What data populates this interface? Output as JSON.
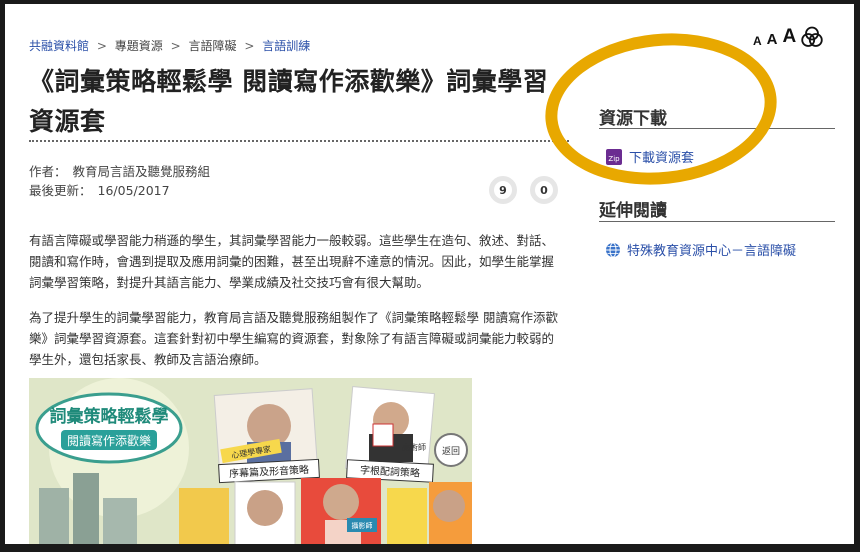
{
  "breadcrumb": {
    "items": [
      "共融資料館",
      "專題資源",
      "言語障礙",
      "言語訓練"
    ],
    "separator": ">"
  },
  "title": "《詞彙策略輕鬆學 閱讀寫作添歡樂》詞彙學習資源套",
  "meta": {
    "author_label": "作者：",
    "author_value": "教育局言語及聽覺服務組",
    "updated_label": "最後更新：",
    "updated_value": "16/05/2017",
    "like_count": "9",
    "share_count": "0"
  },
  "paragraphs": [
    "有語言障礙或學習能力稍遜的學生，其詞彙學習能力一般較弱。這些學生在造句、敘述、對話、閱讀和寫作時，會遇到提取及應用詞彙的困難，甚至出現辭不達意的情況。因此，如學生能掌握詞彙學習策略，對提升其語言能力、學業成績及社交技巧會有很大幫助。",
    "為了提升學生的詞彙學習能力，教育局言語及聽覺服務組製作了《詞彙策略輕鬆學 閱讀寫作添歡樂》詞彙學習資源套。這套針對初中學生編寫的資源套，對象除了有語言障礙或詞彙能力較弱的學生外，還包括家長、教師及言語治療師。"
  ],
  "banner": {
    "logo_title": "詞彙策略輕鬆學",
    "logo_subtitle": "閱讀寫作添歡樂",
    "back_label": "返回",
    "card1_label": "序幕篇及形音策略",
    "card2_label": "字根配詞策略",
    "tag1": "心理學專家",
    "tag2": "魔術師",
    "tag3": "攝影師"
  },
  "font_tools": {
    "small": "A",
    "medium": "A",
    "large": "A"
  },
  "sidebar": {
    "resources_heading": "資源下載",
    "download_link": "下載資源套",
    "zip_label": "Zip",
    "extended_heading": "延伸閱讀",
    "extended_link": "特殊教育資源中心－言語障礙"
  },
  "colors": {
    "link": "#2a4fa8",
    "highlight": "#e8a800",
    "zip_badge": "#6b2c91"
  }
}
